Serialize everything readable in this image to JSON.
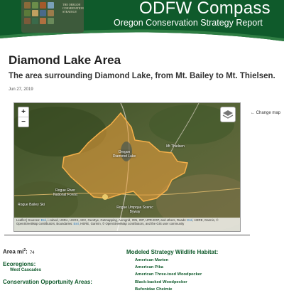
{
  "header": {
    "title": "ODFW Compass",
    "subtitle": "Oregon Conservation Strategy Report",
    "logo_text": "THE OREGON CONSERVATION STRATEGY",
    "brand_color": "#0f5a2b"
  },
  "report": {
    "title": "Diamond Lake Area",
    "description": "The area surrounding Diamond Lake, from Mt. Bailey to Mt. Thielsen.",
    "date": "Jun 27, 2019"
  },
  "map": {
    "zoom_in": "+",
    "zoom_out": "−",
    "layers_icon": "layers-icon",
    "labels": {
      "diamond_lake": "Oregon Diamond Lake",
      "mt_thielsen": "Mt Thielsen",
      "rogue_river": "Rogue River National Forest",
      "rogue_umpqua": "Rogue Umpqua Scenic Byway",
      "mt_bailey": "Rogue Bailey Ski"
    },
    "attribution_prefix": "Leaflet | Sources: ",
    "attribution_link1": "Esri",
    "attribution_mid": ", i-cubed, USDA, USGS, AEX, GeoEye, Getmapping, Aerogrid, IGN, IGP, UPR-EGP, and others, Roads: ",
    "attribution_link2": "Esri",
    "attribution_mid2": ", HERE, Garmin, © OpenStreetMap contributors, Boundaries: ",
    "attribution_link3": "Esri",
    "attribution_end": ", HERE, Garmin, © OpenStreetMap contributors, and the GIS user community",
    "highlight_color": "#f0a13a"
  },
  "change_map_label": "← Change map",
  "stats": {
    "area_label": "Area mi",
    "area_sup": "2",
    "area_colon": ":",
    "area_value": "74",
    "ecoregions_label": "Ecoregions:",
    "ecoregions_value": "West Cascades",
    "cons_label": "Conservation Opportunity Areas:"
  },
  "wildlife": {
    "title": "Modeled Strategy Wildlife Habitat:",
    "items": [
      "American Marten",
      "American Pika",
      "American Three-toed Woodpecker",
      "Black-backed Woodpecker",
      "Bufonidae Cheimie"
    ]
  }
}
